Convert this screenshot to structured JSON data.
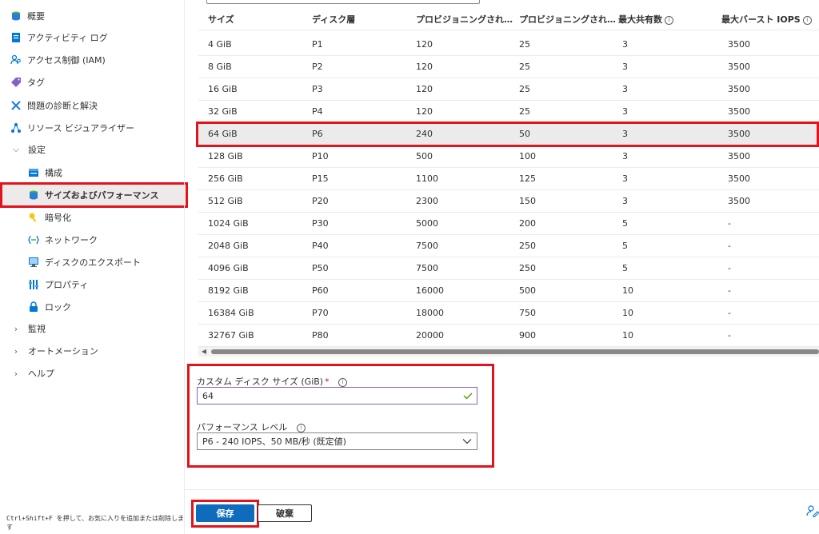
{
  "sidebar": {
    "items": [
      {
        "label": "概要",
        "icon": "overview-icon"
      },
      {
        "label": "アクティビティ ログ",
        "icon": "activity-log-icon"
      },
      {
        "label": "アクセス制御 (IAM)",
        "icon": "iam-icon"
      },
      {
        "label": "タグ",
        "icon": "tag-icon"
      },
      {
        "label": "問題の診断と解決",
        "icon": "diagnose-icon"
      },
      {
        "label": "リソース ビジュアライザー",
        "icon": "visualizer-icon"
      }
    ],
    "settings_group": {
      "label": "設定",
      "expanded": true,
      "items": [
        {
          "label": "構成",
          "icon": "configuration-icon"
        },
        {
          "label": "サイズおよびパフォーマンス",
          "icon": "disk-icon",
          "selected": true
        },
        {
          "label": "暗号化",
          "icon": "encryption-icon"
        },
        {
          "label": "ネットワーク",
          "icon": "network-icon"
        },
        {
          "label": "ディスクのエクスポート",
          "icon": "export-icon"
        },
        {
          "label": "プロパティ",
          "icon": "properties-icon"
        },
        {
          "label": "ロック",
          "icon": "lock-icon"
        }
      ]
    },
    "collapsed_groups": [
      {
        "label": "監視"
      },
      {
        "label": "オートメーション"
      },
      {
        "label": "ヘルプ"
      }
    ],
    "shortcut_hint": "Ctrl+Shift+F を押して、お気に入りを追加または削除します"
  },
  "table": {
    "headers": [
      "サイズ",
      "ディスク層",
      "プロビジョニングされ…",
      "プロビジョニングされ…",
      "最大共有数",
      "最大バースト IOPS"
    ],
    "rows": [
      [
        "4 GiB",
        "P1",
        "120",
        "25",
        "3",
        "3500"
      ],
      [
        "8 GiB",
        "P2",
        "120",
        "25",
        "3",
        "3500"
      ],
      [
        "16 GiB",
        "P3",
        "120",
        "25",
        "3",
        "3500"
      ],
      [
        "32 GiB",
        "P4",
        "120",
        "25",
        "3",
        "3500"
      ],
      [
        "64 GiB",
        "P6",
        "240",
        "50",
        "3",
        "3500"
      ],
      [
        "128 GiB",
        "P10",
        "500",
        "100",
        "3",
        "3500"
      ],
      [
        "256 GiB",
        "P15",
        "1100",
        "125",
        "3",
        "3500"
      ],
      [
        "512 GiB",
        "P20",
        "2300",
        "150",
        "3",
        "3500"
      ],
      [
        "1024 GiB",
        "P30",
        "5000",
        "200",
        "5",
        "-"
      ],
      [
        "2048 GiB",
        "P40",
        "7500",
        "250",
        "5",
        "-"
      ],
      [
        "4096 GiB",
        "P50",
        "7500",
        "250",
        "5",
        "-"
      ],
      [
        "8192 GiB",
        "P60",
        "16000",
        "500",
        "10",
        "-"
      ],
      [
        "16384 GiB",
        "P70",
        "18000",
        "750",
        "10",
        "-"
      ],
      [
        "32767 GiB",
        "P80",
        "20000",
        "900",
        "10",
        "-"
      ]
    ],
    "selected_row_index": 4
  },
  "form": {
    "custom_size_label": "カスタム ディスク サイズ (GiB)",
    "custom_size_required": "*",
    "custom_size_value": "64",
    "performance_label": "パフォーマンス レベル",
    "performance_value": "P6 - 240 IOPS、50 MB/秒 (既定値)"
  },
  "footer": {
    "save_label": "保存",
    "discard_label": "破棄"
  },
  "colors": {
    "highlight_border": "#e3121c",
    "primary_button": "#0f6cbd",
    "input_focus": "#8764b8",
    "valid_check": "#57a300"
  }
}
